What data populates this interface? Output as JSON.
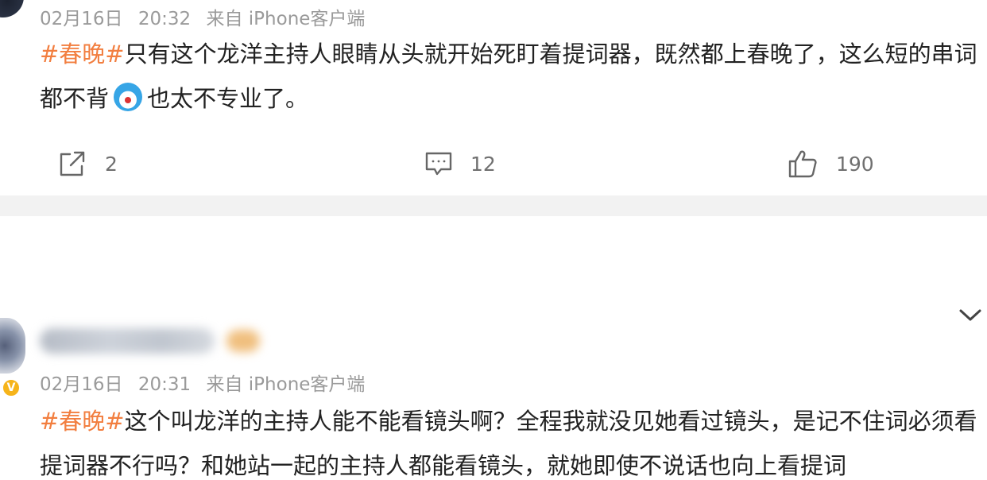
{
  "post1": {
    "timestamp_date": "02月16日",
    "timestamp_time": "20:32",
    "source": "来自 iPhone客户端",
    "topic": "#春晚#",
    "text_before_emoji": "只有这个龙洋主持人眼睛从头就开始死盯着提词器，既然都上春晚了，这么短的串词都不背",
    "emoji": "doraemon-emoji",
    "text_after_emoji": "也太不专业了。",
    "actions": {
      "share_count": "2",
      "comment_count": "12",
      "like_count": "190"
    }
  },
  "post2": {
    "timestamp_date": "02月16日",
    "timestamp_time": "20:31",
    "source": "来自 iPhone客户端",
    "topic": "#春晚#",
    "text": "这个叫龙洋的主持人能不能看镜头啊？全程我就没见她看过镜头，是记不住词必须看提词器不行吗？和她站一起的主持人都能看镜头，就她即使不说话也向上看提词",
    "verified_badge": "V"
  },
  "colors": {
    "topic": "#f27e3f",
    "meta": "#9a9a9a",
    "divider": "#f2f2f2",
    "verified": "#f6b41a"
  },
  "icons": [
    "share-icon",
    "comment-icon",
    "like-icon",
    "chevron-down-icon",
    "verified-icon"
  ]
}
